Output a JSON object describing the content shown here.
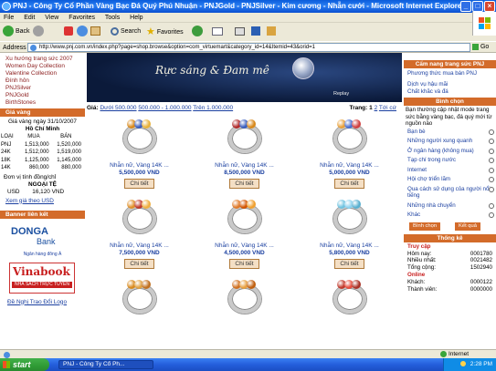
{
  "window": {
    "title": "PNJ - Công Ty Cổ Phần Vàng Bạc Đá Quý Phú Nhuận - PNJGold - PNJSilver - Kim cương - Nhẫn cưới - Microsoft Internet Explorer",
    "controls": [
      "_",
      "□",
      "×"
    ]
  },
  "menu": [
    "File",
    "Edit",
    "View",
    "Favorites",
    "Tools",
    "Help"
  ],
  "toolbar": {
    "back": "Back",
    "search": "Search",
    "favorites": "Favorites"
  },
  "address": {
    "label": "Address",
    "url": "http://www.pnj.com.vn/index.php?page=shop.browse&option=com_virtuemart&category_id=14&Itemid=43&orid=1",
    "go": "Go"
  },
  "left": {
    "top_links": [
      "Xu hướng trang sức 2007",
      "Women Day Collection",
      "Valentine Collection",
      "Đính hôn",
      "PNJSilver",
      "PNJGold",
      "BirthStones"
    ],
    "gold_header": "Giá vàng",
    "gold_date": "Giá vàng ngày 31/10/2007",
    "gold_city": "Hồ Chí Minh",
    "gold_cols": [
      "LOẠI",
      "MUA",
      "BÁN"
    ],
    "gold_rows": [
      [
        "PNJ",
        "1,513,000",
        "1,520,000"
      ],
      [
        "24K",
        "1,512,000",
        "1,519,000"
      ],
      [
        "18K",
        "1,125,000",
        "1,145,000"
      ],
      [
        "14K",
        "860,000",
        "880,000"
      ]
    ],
    "gold_unit": "Đơn vị tính đồng/chỉ",
    "fx_title": "NGOẠI TỆ",
    "fx_row": [
      "USD",
      "16,120 VND"
    ],
    "fx_link": "Xem giá theo USD",
    "banner_header": "Banner liên kết",
    "donga": "DONGA",
    "donga_bank": "Bank",
    "donga_sub": "Ngân hàng đông Á",
    "vinabook": "Vinabook",
    "vinabook_sub": "NHÀ SÁCH TRỰC TUYẾN",
    "partner": "Đề Nghị Trao Đổi Logo"
  },
  "center": {
    "banner_text": "Rực sáng & Đam mê",
    "banner_replay": "Replay",
    "filter_label": "Giá:",
    "filters": [
      "Dưới 500.000",
      "500.000 - 1.000.000",
      "Trên 1.000.000"
    ],
    "page_label": "Trang:",
    "pages": [
      "1",
      "2"
    ],
    "next": "Tới cứ",
    "detail_label": "Chi tiết",
    "products": [
      {
        "name": "Nhẫn nữ, Vàng 14K ...",
        "price": "5,500,000 VND",
        "gems": [
          "#d8891c",
          "#3a5fbf",
          "#e8b23a"
        ]
      },
      {
        "name": "Nhẫn nữ, Vàng 14K ...",
        "price": "8,500,000 VND",
        "gems": [
          "#b02a2a",
          "#3a5fbf",
          "#d8891c"
        ]
      },
      {
        "name": "Nhẫn nữ, Vàng 14K ...",
        "price": "5,000,000 VND",
        "gems": [
          "#e8a03a",
          "#4a6fd0",
          "#d04040"
        ]
      },
      {
        "name": "Nhẫn nữ, Vàng 14K ...",
        "price": "7,500,000 VND",
        "gems": [
          "#e0902a",
          "#c0392b",
          "#f0b040"
        ]
      },
      {
        "name": "Nhẫn nữ, Vàng 14K ...",
        "price": "4,500,000 VND",
        "gems": [
          "#e07a2a",
          "#d35400",
          "#f0a030"
        ]
      },
      {
        "name": "Nhẫn nữ, Vàng 14K ...",
        "price": "5,800,000 VND",
        "gems": [
          "#6fc3e0",
          "#8fd3f0",
          "#5ab0d0"
        ]
      },
      {
        "name": "",
        "price": "",
        "gems": [
          "#d8891c",
          "#e0a040",
          "#c07020"
        ]
      },
      {
        "name": "",
        "price": "",
        "gems": [
          "#d07020",
          "#e8a040",
          "#c06010"
        ]
      },
      {
        "name": "",
        "price": "",
        "gems": [
          "#c0392b",
          "#e74c3c",
          "#a93226"
        ]
      }
    ]
  },
  "right": {
    "guide_header": "Cẩm nang trang sức PNJ",
    "guide_links": [
      "Phương thức mua bán PNJ",
      "Dịch vụ hậu mãi",
      "Chất khắc và đá"
    ],
    "poll_header": "Bình chọn",
    "poll_question": "Bạn thường cập nhật mode trang sức bằng vàng bạc, đá quý mới từ nguồn nào",
    "poll_options": [
      "Bạn bè",
      "Những người xung quanh",
      "Ở ngân hàng (không mua)",
      "Tạp chí trong nước",
      "Internet",
      "Hội chợ triển lãm",
      "Qua cách sử dụng của người nổi tiếng",
      "Những nhà chuyển",
      "Khác"
    ],
    "vote": "Bình chọn",
    "result": "Kết quả",
    "stats_header": "Thống kê",
    "stats_title": "Truy cập",
    "stats": [
      [
        "Hôm nay:",
        "0001780"
      ],
      [
        "Nhiều nhất:",
        "0021482"
      ],
      [
        "Tổng cộng:",
        "1502940"
      ]
    ],
    "online_title": "Online",
    "online_rows": [
      [
        "Khách:",
        "0000122"
      ],
      [
        "Thành viên:",
        "0000000"
      ]
    ]
  },
  "status": {
    "zone": "Internet"
  },
  "taskbar": {
    "start": "start",
    "task": "PNJ - Công Ty Cổ Ph...",
    "clock": "2:28 PM"
  }
}
